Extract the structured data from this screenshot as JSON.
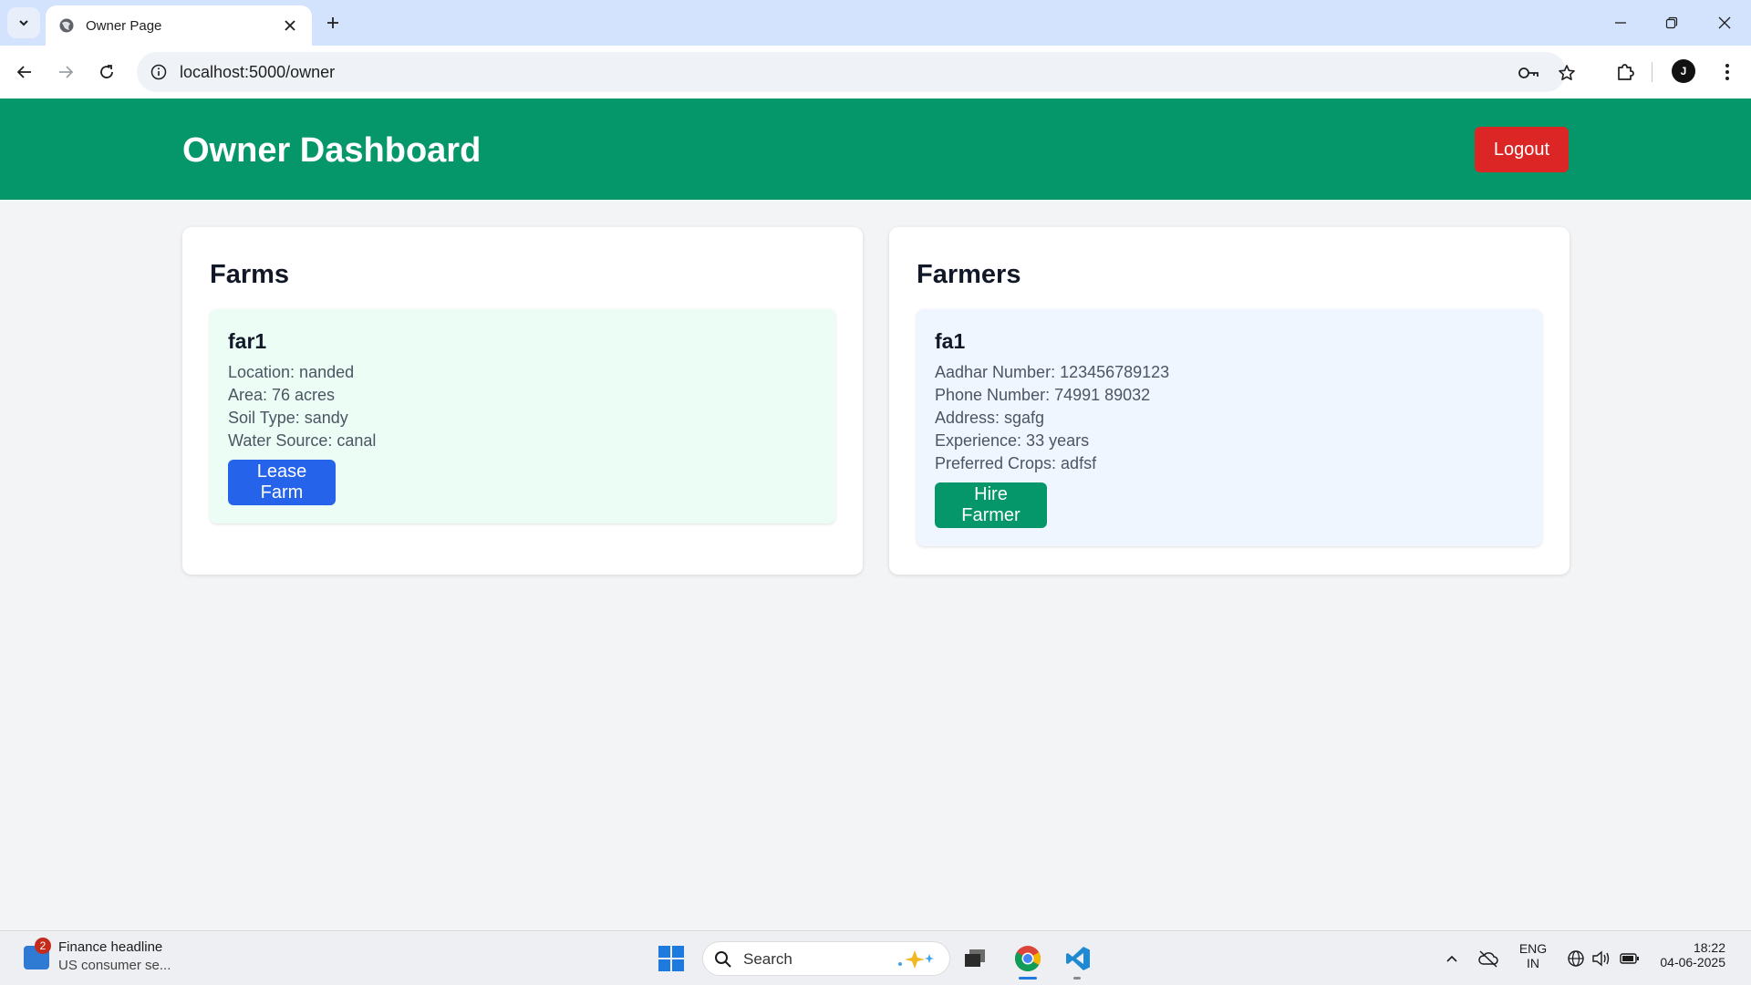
{
  "browser": {
    "tab_title": "Owner Page",
    "url": "localhost:5000/owner",
    "avatar_initial": "J"
  },
  "header": {
    "title": "Owner Dashboard",
    "logout_label": "Logout",
    "color": "#059669"
  },
  "farms": {
    "title": "Farms",
    "items": [
      {
        "name": "far1",
        "location": "Location: nanded",
        "area": "Area: 76 acres",
        "soil_type": "Soil Type: sandy",
        "water_source": "Water Source: canal",
        "action_label": "Lease Farm"
      }
    ]
  },
  "farmers": {
    "title": "Farmers",
    "items": [
      {
        "name": "fa1",
        "aadhar": "Aadhar Number: 123456789123",
        "phone": "Phone Number: 74991 89032",
        "address": "Address: sgafg",
        "experience": "Experience: 33 years",
        "preferred_crops": "Preferred Crops: adfsf",
        "action_label": "Hire Farmer"
      }
    ]
  },
  "taskbar": {
    "news_badge": "2",
    "news_title": "Finance headline",
    "news_subtitle": "US consumer se...",
    "search_label": "Search",
    "language_top": "ENG",
    "language_bottom": "IN",
    "time": "18:22",
    "date": "04-06-2025"
  },
  "colors": {
    "lease_button": "#2563eb",
    "hire_button": "#059669",
    "logout_button": "#dc2626",
    "farm_card": "#ecfdf5",
    "farmer_card": "#eff6ff"
  }
}
